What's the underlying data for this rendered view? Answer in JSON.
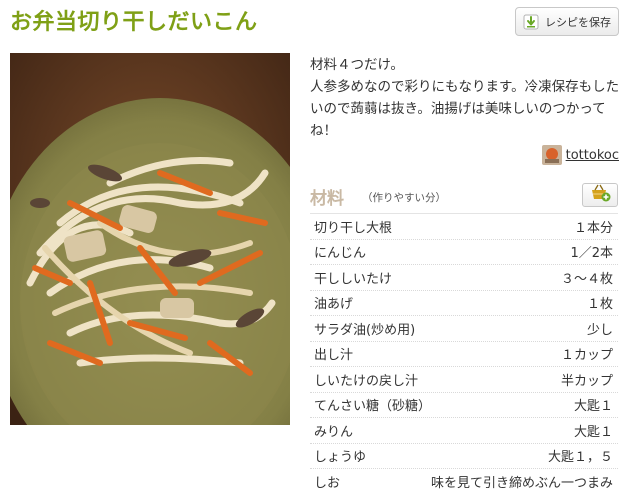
{
  "recipe": {
    "title": "お弁当切り干しだいこん",
    "save_label": "レシピを保存",
    "description": "材料４つだけ。\n人参多めなので彩りにもなります。冷凍保存もしたいので蒟蒻は抜き。油揚げは美味しいのつかってね！",
    "author": "tottokoc"
  },
  "ingredients": {
    "title": "材料",
    "subtitle": "（作りやすい分）",
    "items": [
      {
        "name": "切り干し大根",
        "qty": "１本分"
      },
      {
        "name": "にんじん",
        "qty": "1／2本"
      },
      {
        "name": "干ししいたけ",
        "qty": "３〜４枚"
      },
      {
        "name": "油あげ",
        "qty": "１枚"
      },
      {
        "name": "サラダ油(炒め用)",
        "qty": "少し"
      },
      {
        "name": "出し汁",
        "qty": "１カップ"
      },
      {
        "name": "しいたけの戻し汁",
        "qty": "半カップ"
      },
      {
        "name": "てんさい糖（砂糖）",
        "qty": "大匙１"
      },
      {
        "name": "みりん",
        "qty": "大匙１"
      },
      {
        "name": "しょうゆ",
        "qty": "大匙１，５"
      },
      {
        "name": "しお",
        "qty": "味を見て引き締めぶん一つまみ"
      }
    ]
  },
  "icons": {
    "save": "download-arrow-icon",
    "basket": "shopping-basket-add-icon"
  },
  "colors": {
    "title": "#7fa016",
    "ingredients_title": "#c9b9a4",
    "accent_green": "#6aa827"
  }
}
